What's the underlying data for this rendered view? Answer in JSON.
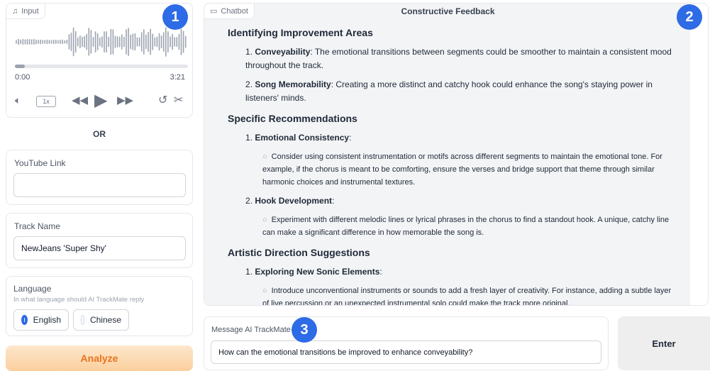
{
  "input_panel": {
    "tag_label": "Input",
    "time_start": "0:00",
    "time_end": "3:21",
    "speed": "1x",
    "progress": 0.0
  },
  "or_label": "OR",
  "youtube": {
    "label": "YouTube Link",
    "value": ""
  },
  "track": {
    "label": "Track Name",
    "value": "NewJeans 'Super Shy'"
  },
  "language": {
    "label": "Language",
    "hint": "In what language should AI TrackMate reply",
    "options": [
      "English",
      "Chinese"
    ],
    "selected": "English"
  },
  "analyze_label": "Analyze",
  "chatbot": {
    "tag_label": "Chatbot",
    "title": "Constructive Feedback",
    "sec1": {
      "heading": "Identifying Improvement Areas",
      "i1_num": "1.",
      "i1_bold": "Conveyability",
      "i1_text": ": The emotional transitions between segments could be smoother to maintain a consistent mood throughout the track.",
      "i2_num": "2.",
      "i2_bold": "Song Memorability",
      "i2_text": ": Creating a more distinct and catchy hook could enhance the song's staying power in listeners' minds."
    },
    "sec2": {
      "heading": "Specific Recommendations",
      "i1_num": "1.",
      "i1_bold": "Emotional Consistency",
      "i1_text": ":",
      "i1_sub": "Consider using consistent instrumentation or motifs across different segments to maintain the emotional tone. For example, if the chorus is meant to be comforting, ensure the verses and bridge support that theme through similar harmonic choices and instrumental textures.",
      "i2_num": "2.",
      "i2_bold": "Hook Development",
      "i2_text": ":",
      "i2_sub": "Experiment with different melodic lines or lyrical phrases in the chorus to find a standout hook. A unique, catchy line can make a significant difference in how memorable the song is."
    },
    "sec3": {
      "heading": "Artistic Direction Suggestions",
      "i1_num": "1.",
      "i1_bold": "Exploring New Sonic Elements",
      "i1_text": ":",
      "i1_sub": "Introduce unconventional instruments or sounds to add a fresh layer of creativity. For instance, adding a subtle layer of live percussion or an unexpected instrumental solo could make the track more original."
    }
  },
  "message": {
    "label": "Message AI TrackMate",
    "value": "How can the emotional transitions be improved to enhance conveyability?"
  },
  "enter_label": "Enter",
  "badges": {
    "b1": "1",
    "b2": "2",
    "b3": "3"
  },
  "colors": {
    "accent": "#2e6be6",
    "analyze_bg": "#fcd9b0",
    "analyze_text": "#e8731d"
  }
}
